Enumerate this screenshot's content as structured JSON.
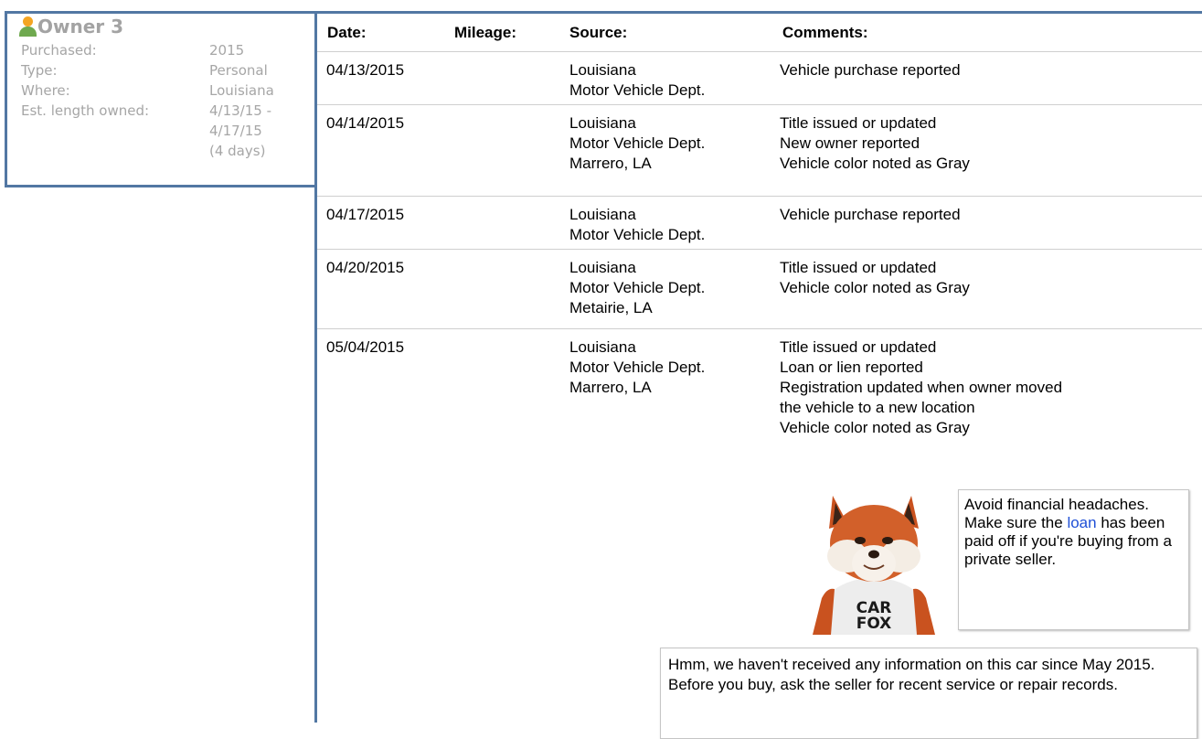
{
  "owner": {
    "title": "Owner 3",
    "rows": [
      {
        "label": "Purchased:",
        "value": "2015"
      },
      {
        "label": "Type:",
        "value": "Personal"
      },
      {
        "label": "Where:",
        "value": "Louisiana"
      },
      {
        "label": "Est. length owned:",
        "value_lines": [
          "4/13/15 -",
          "4/17/15",
          "(4 days)"
        ]
      }
    ]
  },
  "table": {
    "headers": {
      "date": "Date:",
      "mileage": "Mileage:",
      "source": "Source:",
      "comments": "Comments:"
    },
    "rows": [
      {
        "date": "04/13/2015",
        "source": [
          "Louisiana",
          "Motor Vehicle Dept."
        ],
        "comments": [
          "Vehicle purchase reported"
        ]
      },
      {
        "date": "04/14/2015",
        "source": [
          "Louisiana",
          "Motor Vehicle Dept.",
          "Marrero, LA"
        ],
        "comments": [
          "Title issued or updated",
          "New owner reported",
          "Vehicle color noted as Gray"
        ]
      },
      {
        "date": "04/17/2015",
        "source": [
          "Louisiana",
          "Motor Vehicle Dept."
        ],
        "comments": [
          "Vehicle purchase reported"
        ]
      },
      {
        "date": "04/20/2015",
        "source": [
          "Louisiana",
          "Motor Vehicle Dept.",
          "Metairie, LA"
        ],
        "comments": [
          "Title issued or updated",
          "Vehicle color noted as Gray"
        ]
      },
      {
        "date": "05/04/2015",
        "source": [
          "Louisiana",
          "Motor Vehicle Dept.",
          "Marrero, LA"
        ],
        "comments": [
          "Title issued or updated",
          "Loan or lien reported",
          "Registration updated when owner moved",
          "the vehicle to a new location",
          "Vehicle color noted as Gray"
        ]
      }
    ]
  },
  "tip": {
    "before": "Avoid financial headaches. Make sure the ",
    "link": "loan",
    "after": " has been paid off if you're buying from a private seller.",
    "fox_shirt_line1": "CAR",
    "fox_shirt_line2": "FOX"
  },
  "info": {
    "text": "Hmm, we haven't received any information on this car since May 2015. Before you buy, ask the seller for recent service or repair records."
  },
  "colors": {
    "border": "#5277a3",
    "muted_text": "#a6a6a6",
    "link": "#1f4fd6"
  }
}
